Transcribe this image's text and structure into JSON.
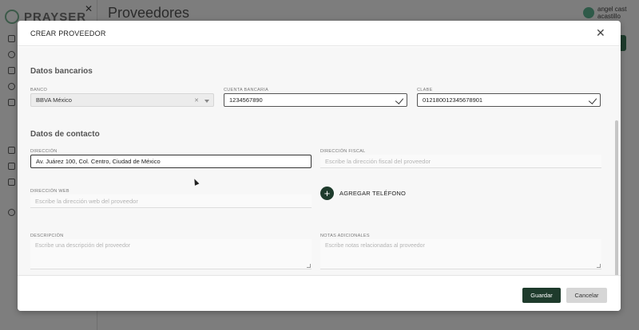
{
  "app": {
    "brand": "PRAYSER",
    "page_title": "Proveedores",
    "user_name": "angel cast",
    "user_handle": "acastillo"
  },
  "modal": {
    "title": "CREAR PROVEEDOR",
    "bank_section": {
      "title": "Datos bancarios",
      "bank_label": "BANCO",
      "bank_value": "BBVA México",
      "account_label": "CUENTA BANCARIA",
      "account_value": "1234567890",
      "clabe_label": "CLABE",
      "clabe_value": "012180012345678901"
    },
    "contact_section": {
      "title": "Datos de contacto",
      "address_label": "DIRECCIÓN",
      "address_value": "Av. Juárez 100, Col. Centro, Ciudad de México",
      "fiscal_label": "DIRECCIÓN FISCAL",
      "fiscal_placeholder": "Escribe la dirección fiscal del proveedor",
      "web_label": "DIRECCIÓN WEB",
      "web_placeholder": "Escribe la dirección web del proveedor",
      "add_phone_label": "AGREGAR TELÉFONO",
      "description_label": "DESCRIPCIÓN",
      "description_placeholder": "Escribe una descripción del proveedor",
      "notes_label": "NOTAS ADICIONALES",
      "notes_placeholder": "Escribe notas relacionadas al proveedor"
    },
    "footer": {
      "save_label": "Guardar",
      "cancel_label": "Cancelar"
    }
  },
  "colors": {
    "brand": "#1e3b2c",
    "overlay": "#7d7d7d"
  }
}
